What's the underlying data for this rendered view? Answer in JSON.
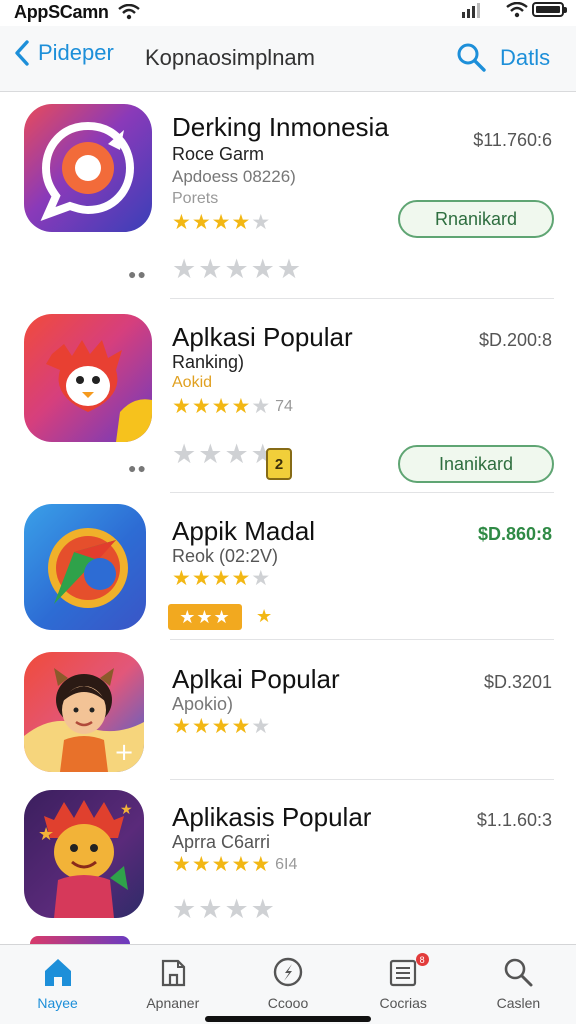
{
  "status": {
    "time": "AppSCamn"
  },
  "nav": {
    "back_label": "Pideper",
    "title": "Kopnaosimplnam",
    "details_label": "Datls"
  },
  "apps": [
    {
      "name": "Derking Inmonesia",
      "sub": "Roce Garm",
      "sub2": "Apdoess 08226)",
      "tag": "Porets",
      "price": "$11.760:6",
      "rating": 4,
      "button": "Rnanikard",
      "second_rating": 0
    },
    {
      "name": "Aplkasi Popular",
      "sub": "Ranking)",
      "rating_label": "Aokid",
      "rating": 4,
      "rating_suffix": "74",
      "price": "$D.200:8",
      "button": "Inanikard",
      "badge": "2"
    },
    {
      "name": "Appik Madal",
      "sub": "Reok (02:2V)",
      "rating": 4,
      "price": "$D.860:8"
    },
    {
      "name": "Aplkai Popular",
      "sub": "Apokio)",
      "rating": 4,
      "price": "$D.3201"
    },
    {
      "name": "Aplikasis Popular",
      "sub": "Aprra C6arri",
      "rating": 5,
      "rating_suffix": "6I4",
      "price": "$1.1.60:3"
    }
  ],
  "tabs": [
    {
      "label": "Nayee",
      "icon": "home-icon"
    },
    {
      "label": "Apnaner",
      "icon": "apps-icon"
    },
    {
      "label": "Ccooo",
      "icon": "explore-icon"
    },
    {
      "label": "Cocrias",
      "icon": "updates-icon",
      "badge": "8"
    },
    {
      "label": "Caslen",
      "icon": "search-icon"
    }
  ],
  "colors": {
    "accent": "#1d8fd9",
    "star": "#f2b714",
    "button_border": "#5fa573",
    "price_green": "#2f8a45"
  }
}
